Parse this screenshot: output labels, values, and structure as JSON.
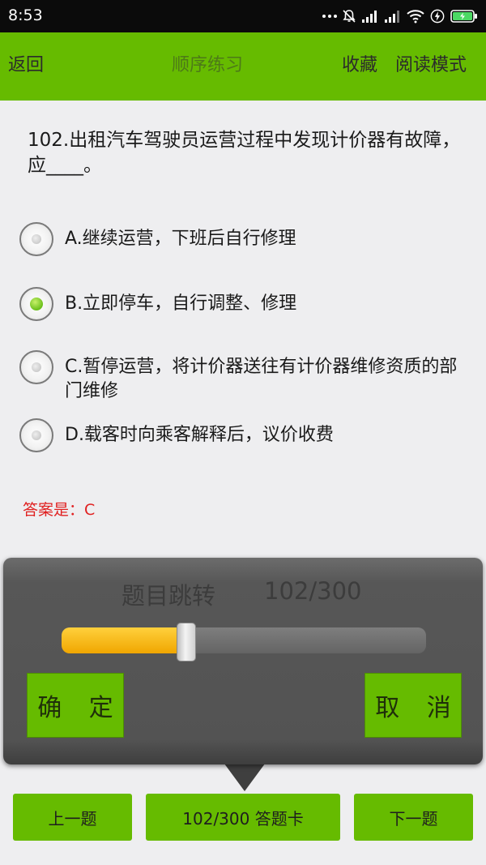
{
  "status_bar": {
    "time": "8:53",
    "icons": [
      "more-dots-icon",
      "mute-icon",
      "signal-icon",
      "signal-icon",
      "wifi-icon",
      "charging-icon",
      "battery-icon"
    ]
  },
  "header": {
    "back": "返回",
    "title": "顺序练习",
    "favorite": "收藏",
    "reading_mode": "阅读模式"
  },
  "question": {
    "text": "102.出租汽车驾驶员运营过程中发现计价器有故障，应____。",
    "options": [
      {
        "label": "A.继续运营，下班后自行修理",
        "selected": false
      },
      {
        "label": "B.立即停车，自行调整、修理",
        "selected": true
      },
      {
        "label": "C.暂停运营，将计价器送往有计价器维修资质的部门维修",
        "selected": false
      },
      {
        "label": "D.载客时向乘客解释后，议价收费",
        "selected": false
      }
    ],
    "answer": "答案是：C"
  },
  "jump_dialog": {
    "title": "题目跳转",
    "progress_text": "102/300",
    "current": 102,
    "total": 300,
    "confirm": "确 定",
    "cancel": "取 消"
  },
  "bottom_nav": {
    "prev": "上一题",
    "card": "102/300 答题卡",
    "next": "下一题"
  },
  "colors": {
    "accent_green": "#66bb00",
    "answer_red": "#e02020",
    "slider_fill": "#f5b400"
  }
}
